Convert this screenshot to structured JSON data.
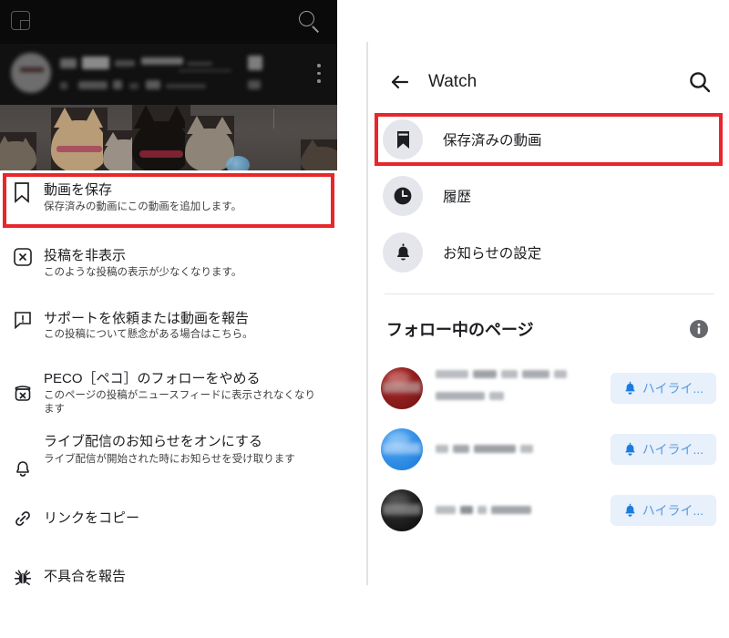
{
  "left_panel": {
    "top_bar": {
      "panel_icon": "panel-collapse-icon",
      "search_icon": "search-icon"
    },
    "post_header": {
      "avatar": "blurred-page-avatar",
      "name_redacted": true,
      "meta_redacted": true,
      "more_icon": "kebab-menu-icon"
    },
    "post_image": {
      "alt": "cats-photo",
      "redacted": false
    },
    "menu_items": [
      {
        "icon": "bookmark-icon",
        "title": "動画を保存",
        "subtitle": "保存済みの動画にこの動画を追加します。",
        "highlighted": true
      },
      {
        "icon": "hide-post-icon",
        "title": "投稿を非表示",
        "subtitle": "このような投稿の表示が少なくなります。",
        "highlighted": false
      },
      {
        "icon": "report-icon",
        "title": "サポートを依頼または動画を報告",
        "subtitle": "この投稿について懸念がある場合はこちら。",
        "highlighted": false
      },
      {
        "icon": "unfollow-icon",
        "title": "PECO［ペコ］のフォローをやめる",
        "subtitle": "このページの投稿がニュースフィードに表示されなくなります",
        "highlighted": false
      },
      {
        "icon": "bell-icon",
        "title": "ライブ配信のお知らせをオンにする",
        "subtitle": "ライブ配信が開始された時にお知らせを受け取ります",
        "highlighted": false
      },
      {
        "icon": "link-icon",
        "title": "リンクをコピー",
        "subtitle": "",
        "highlighted": false
      },
      {
        "icon": "bug-icon",
        "title": "不具合を報告",
        "subtitle": "",
        "highlighted": false
      }
    ]
  },
  "right_panel": {
    "header": {
      "back_icon": "back-arrow-icon",
      "title": "Watch",
      "search_icon": "search-icon"
    },
    "list": [
      {
        "icon": "bookmark-icon",
        "label": "保存済みの動画",
        "highlighted": true
      },
      {
        "icon": "clock-icon",
        "label": "履歴",
        "highlighted": false
      },
      {
        "icon": "bell-icon",
        "label": "お知らせの設定",
        "highlighted": false
      }
    ],
    "section": {
      "title": "フォロー中のページ",
      "info_icon": "info-icon"
    },
    "pages": [
      {
        "avatar_color": "#8d1c1c",
        "name_redacted": true,
        "name_lines": 2,
        "button": {
          "icon": "bell-icon",
          "label": "ハイライ..."
        }
      },
      {
        "avatar_color": "#1a87ea",
        "name_redacted": true,
        "name_lines": 1,
        "button": {
          "icon": "bell-icon",
          "label": "ハイライ..."
        }
      },
      {
        "avatar_color": "#141414",
        "name_redacted": true,
        "name_lines": 1,
        "button": {
          "icon": "bell-icon",
          "label": "ハイライ..."
        }
      }
    ]
  },
  "annotations": {
    "highlight_color": "#e8262b",
    "left_target": "動画を保存",
    "right_target": "保存済みの動画"
  }
}
